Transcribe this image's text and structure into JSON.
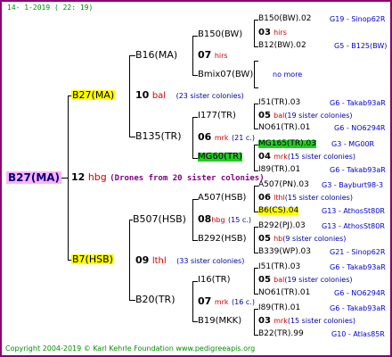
{
  "header": {
    "date": "14-  1-2019  ( 22: 19)"
  },
  "footer": {
    "copyright": "Copyright 2004-2019 © Karl Kehrle Foundation   www.pedigreeapis.org"
  },
  "root": {
    "label": "B27(MA)"
  },
  "gen1": {
    "num": "12",
    "abbr": "hbg",
    "note": "(Drones from 20 sister colonies)"
  },
  "queen_line": {
    "label": "B27(MA)",
    "num": "10",
    "abbr": "bal",
    "note": "(23 sister colonies)",
    "b16": {
      "label": "B16(MA)",
      "num": "07",
      "abbr": "hirs"
    },
    "b135": {
      "label": "B135(TR)",
      "num": "06",
      "abbr": "mrk",
      "note": "(21 c.)"
    }
  },
  "drone_line": {
    "label": "B7(HSB)",
    "num": "09",
    "abbr": "lthl",
    "note": "(33 sister colonies)",
    "b507": {
      "label": "B507(HSB)",
      "num": "08",
      "abbr": "hbg",
      "note": "(15 c.)"
    },
    "b20": {
      "label": "B20(TR)",
      "num": "07",
      "abbr": "mrk",
      "note": "(16 c.)"
    }
  },
  "gen3": {
    "b150": "B150(BW)",
    "bmix": "Bmix07(BW)",
    "i177": "I177(TR)",
    "mg60": "MG60(TR)",
    "a507": "A507(HSB)",
    "b292": "B292(HSB)",
    "i16": "I16(TR)",
    "b19": "B19(MKK)"
  },
  "gen4": {
    "r1": {
      "left": "B150(BW).02",
      "right": "G19 - Sinop62R"
    },
    "r2": {
      "num": "03",
      "abbr": "hirs"
    },
    "r3": {
      "left": "B12(BW).02",
      "right": "G5 - B125(BW)"
    },
    "r4": {
      "center": "no more"
    },
    "r5": {
      "left": "I51(TR).03",
      "right": "G6 - Takab93aR"
    },
    "r6": {
      "num": "05",
      "abbr": "bal",
      "note": "(19 sister colonies)"
    },
    "r7": {
      "left": "NO61(TR).01",
      "right": "G6 - NO6294R"
    },
    "r8": {
      "left": "MG165(TR).03",
      "right": "G3 - MG00R"
    },
    "r9": {
      "num": "04",
      "abbr": "mrk",
      "note": "(15 sister colonies)"
    },
    "r10": {
      "left": "I89(TR).01",
      "right": "G6 - Takab93aR"
    },
    "r11": {
      "left": "A507(PN).03",
      "right": "G3 - Bayburt98-3"
    },
    "r12": {
      "num": "06",
      "abbr": "lthl",
      "note": "(15 sister colonies)"
    },
    "r13": {
      "left": "B6(CS).04",
      "right": "G13 - AthosSt80R"
    },
    "r14": {
      "left": "B292(PJ).03",
      "right": "G13 - AthosSt80R"
    },
    "r15": {
      "num": "05",
      "abbr": "hb",
      "note": "(9 sister colonies)"
    },
    "r16": {
      "left": "B339(WP).03",
      "right": "G21 - Sinop62R"
    },
    "r17": {
      "left": "I51(TR).03",
      "right": "G6 - Takab93aR"
    },
    "r18": {
      "num": "05",
      "abbr": "bal",
      "note": "(19 sister colonies)"
    },
    "r19": {
      "left": "NO61(TR).01",
      "right": "G6 - NO6294R"
    },
    "r20": {
      "left": "I89(TR).01",
      "right": "G6 - Takab93aR"
    },
    "r21": {
      "num": "03",
      "abbr": "mrk",
      "note": "(15 sister colonies)"
    },
    "r22": {
      "left": "B22(TR).99",
      "right": "G10 - Atlas85R"
    }
  },
  "colors": {
    "frame": "#8b0070",
    "green_text": "#009000",
    "blue_text": "#0000cc",
    "red_text": "#cc0000",
    "highlight_yellow": "#ffff00",
    "highlight_green": "#22cc22",
    "root_bg": "#ffb3ff"
  }
}
